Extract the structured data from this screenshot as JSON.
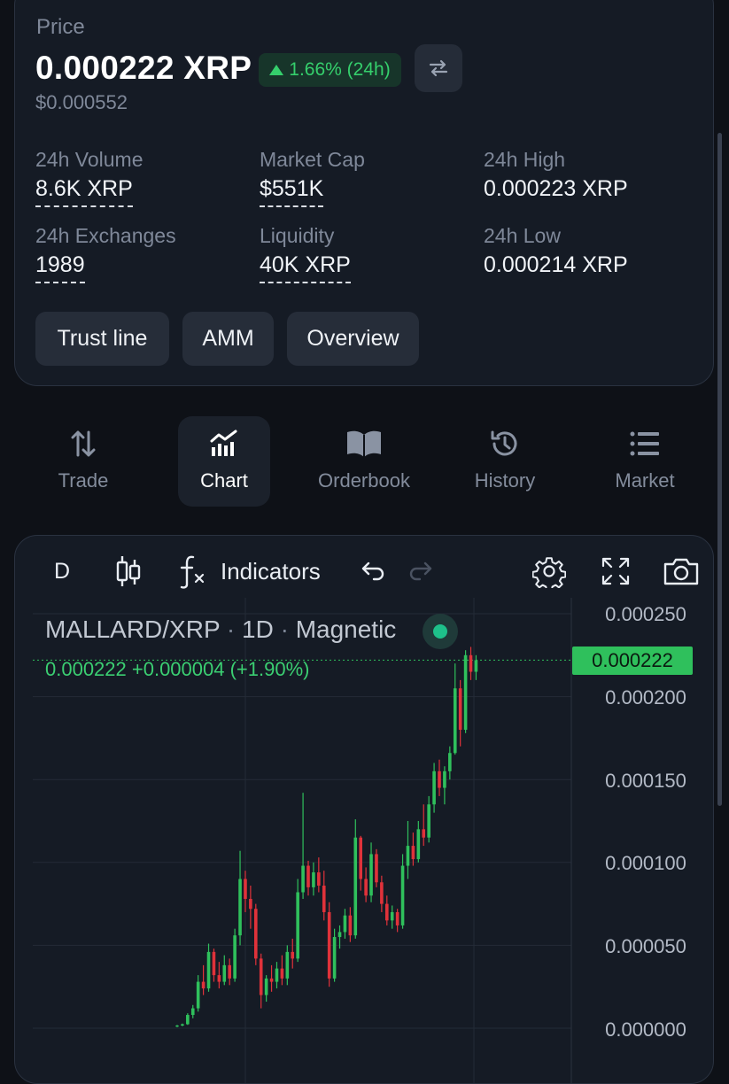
{
  "header": {
    "price_label": "Price",
    "price": "0.000222 XRP",
    "change": "1.66% (24h)",
    "usd_price": "$0.000552"
  },
  "stats": [
    {
      "label": "24h Volume",
      "value": "8.6K XRP"
    },
    {
      "label": "Market Cap",
      "value": "$551K"
    },
    {
      "label": "24h High",
      "value": "0.000223 XRP"
    },
    {
      "label": "24h Exchanges",
      "value": "1989"
    },
    {
      "label": "Liquidity",
      "value": "40K XRP"
    },
    {
      "label": "24h Low",
      "value": "0.000214 XRP"
    }
  ],
  "actions": [
    "Trust line",
    "AMM",
    "Overview"
  ],
  "tabs": [
    {
      "label": "Trade",
      "icon": "trade-arrows-icon"
    },
    {
      "label": "Chart",
      "icon": "chart-bars-icon",
      "active": true
    },
    {
      "label": "Orderbook",
      "icon": "book-icon"
    },
    {
      "label": "History",
      "icon": "history-icon"
    },
    {
      "label": "Market",
      "icon": "list-icon"
    }
  ],
  "chart_toolbar": {
    "interval": "D",
    "indicators": "Indicators"
  },
  "chart_legend": {
    "pair": "MALLARD/XRP",
    "interval": "1D",
    "mode": "Magnetic",
    "sep": "·",
    "ohlc": "0.000222  +0.000004 (+1.90%)"
  },
  "colors": {
    "up": "#2fc05c",
    "down": "#e0323a",
    "accent": "#35cf6c",
    "background": "#0e1117"
  },
  "chart_data": {
    "type": "candlestick",
    "y_ticks": [
      "0.000250",
      "0.000200",
      "0.000150",
      "0.000100",
      "0.000050",
      "0.000000"
    ],
    "ylim": [
      0,
      0.00025
    ],
    "current_price": "0.000222",
    "x_range": [
      0,
      100
    ],
    "candles": [
      [
        0,
        1e-06,
        2e-06,
        6e-07,
        1.6e-06
      ],
      [
        1,
        1.6e-06,
        2.8e-06,
        1.2e-06,
        2.4e-06
      ],
      [
        2,
        2.4e-06,
        9e-06,
        2e-06,
        8e-06
      ],
      [
        3,
        8e-06,
        1.4e-05,
        6e-06,
        1.2e-05
      ],
      [
        4,
        1.2e-05,
        3.2e-05,
        1e-05,
        2.8e-05
      ],
      [
        5,
        2.8e-05,
        3.8e-05,
        2e-05,
        2.4e-05
      ],
      [
        6,
        2.4e-05,
        5.1e-05,
        2.2e-05,
        4.6e-05
      ],
      [
        7,
        4.6e-05,
        4.8e-05,
        2.8e-05,
        3.2e-05
      ],
      [
        8,
        3.2e-05,
        4e-05,
        2.4e-05,
        2.8e-05
      ],
      [
        9,
        2.8e-05,
        4.4e-05,
        2.6e-05,
        3.8e-05
      ],
      [
        10,
        3.8e-05,
        4.2e-05,
        2.6e-05,
        3e-05
      ],
      [
        11,
        3e-05,
        6e-05,
        2.8e-05,
        5.6e-05
      ],
      [
        12,
        5.6e-05,
        0.000107,
        5e-05,
        9e-05
      ],
      [
        13,
        9e-05,
        9.5e-05,
        7e-05,
        7.8e-05
      ],
      [
        14,
        7.8e-05,
        8.6e-05,
        6e-05,
        7.2e-05
      ],
      [
        15,
        7.2e-05,
        7.5e-05,
        3.8e-05,
        4.2e-05
      ],
      [
        16,
        4.2e-05,
        4.5e-05,
        1.2e-05,
        2e-05
      ],
      [
        17,
        2e-05,
        3.2e-05,
        1.6e-05,
        3e-05
      ],
      [
        18,
        3e-05,
        3.8e-05,
        2.2e-05,
        2.8e-05
      ],
      [
        19,
        2.8e-05,
        4e-05,
        2.4e-05,
        3.6e-05
      ],
      [
        20,
        3.6e-05,
        4.4e-05,
        2.6e-05,
        3e-05
      ],
      [
        21,
        3e-05,
        5e-05,
        2.6e-05,
        4.6e-05
      ],
      [
        22,
        4.6e-05,
        5.4e-05,
        3.6e-05,
        4.2e-05
      ],
      [
        23,
        4.2e-05,
        9e-05,
        4e-05,
        8.2e-05
      ],
      [
        24,
        8.2e-05,
        0.000142,
        7.8e-05,
        9.8e-05
      ],
      [
        25,
        9.8e-05,
        0.000101,
        8e-05,
        8.5e-05
      ],
      [
        26,
        8.5e-05,
        0.0001,
        8e-05,
        9.4e-05
      ],
      [
        27,
        9.4e-05,
        0.000103,
        8.2e-05,
        8.6e-05
      ],
      [
        28,
        8.6e-05,
        9.5e-05,
        6.5e-05,
        7e-05
      ],
      [
        29,
        7e-05,
        7.6e-05,
        2.5e-05,
        3e-05
      ],
      [
        30,
        3e-05,
        6e-05,
        2.8e-05,
        5.5e-05
      ],
      [
        31,
        5.5e-05,
        6.2e-05,
        4.8e-05,
        5.8e-05
      ],
      [
        32,
        5.8e-05,
        7.2e-05,
        5.4e-05,
        6.8e-05
      ],
      [
        33,
        6.8e-05,
        7.3e-05,
        5.2e-05,
        5.6e-05
      ],
      [
        34,
        5.6e-05,
        0.000126,
        5.4e-05,
        0.000115
      ],
      [
        35,
        0.000115,
        0.000116,
        8.3e-05,
        9e-05
      ],
      [
        36,
        9e-05,
        9.7e-05,
        7.6e-05,
        8e-05
      ],
      [
        37,
        8e-05,
        0.000112,
        7.6e-05,
        0.000105
      ],
      [
        38,
        0.000105,
        0.000108,
        8.5e-05,
        8.8e-05
      ],
      [
        39,
        8.8e-05,
        9.2e-05,
        7e-05,
        7.5e-05
      ],
      [
        40,
        7.5e-05,
        8e-05,
        6.2e-05,
        6.5e-05
      ],
      [
        41,
        6.5e-05,
        7.4e-05,
        6e-05,
        7e-05
      ],
      [
        42,
        7e-05,
        7.2e-05,
        5.8e-05,
        6.2e-05
      ],
      [
        43,
        6.2e-05,
        0.000105,
        6e-05,
        9.8e-05
      ],
      [
        44,
        9.8e-05,
        0.000125,
        9e-05,
        0.00011
      ],
      [
        45,
        0.00011,
        0.000118,
        9.8e-05,
        0.000102
      ],
      [
        46,
        0.000102,
        0.000125,
        0.0001,
        0.00012
      ],
      [
        47,
        0.00012,
        0.000135,
        0.00011,
        0.000115
      ],
      [
        48,
        0.000115,
        0.00014,
        0.000112,
        0.000135
      ],
      [
        49,
        0.000135,
        0.00016,
        0.00013,
        0.000155
      ],
      [
        50,
        0.000155,
        0.000162,
        0.00014,
        0.000145
      ],
      [
        51,
        0.000145,
        0.000158,
        0.000135,
        0.000155
      ],
      [
        52,
        0.000155,
        0.00017,
        0.00015,
        0.000166
      ],
      [
        53,
        0.000166,
        0.00022,
        0.000165,
        0.000205
      ],
      [
        54,
        0.000205,
        0.00021,
        0.00017,
        0.00018
      ],
      [
        55,
        0.00018,
        0.000228,
        0.000178,
        0.000225
      ],
      [
        56,
        0.000225,
        0.00023,
        0.00021,
        0.000215
      ],
      [
        57,
        0.000215,
        0.000225,
        0.00021,
        0.000222
      ]
    ]
  }
}
